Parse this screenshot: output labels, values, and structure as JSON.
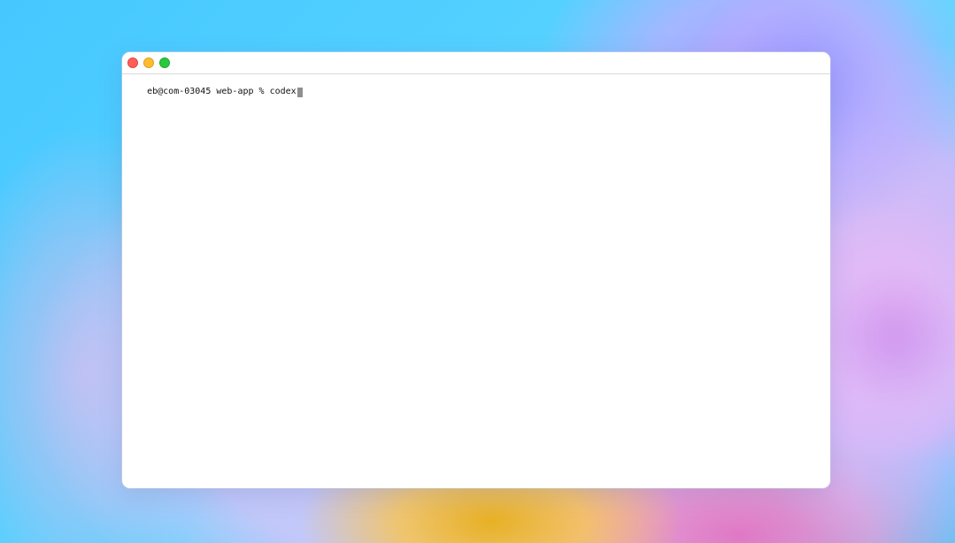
{
  "colors": {
    "desktop_background": "#48ccff",
    "window_background": "#ffffff",
    "titlebar_border": "#dadada",
    "terminal_text": "#111111",
    "cursor": "#8f8f8f",
    "close": "#ff5f57",
    "minimize": "#febc2e",
    "zoom": "#28c840"
  },
  "window": {
    "traffic_lights": [
      {
        "name": "close",
        "icon": "close-circle-icon"
      },
      {
        "name": "minimize",
        "icon": "minimize-circle-icon"
      },
      {
        "name": "zoom",
        "icon": "zoom-circle-icon"
      }
    ]
  },
  "terminal": {
    "line": {
      "prompt": "eb@com-03045 web-app % ",
      "command": "codex"
    },
    "cursor_icon": "text-cursor-icon"
  }
}
